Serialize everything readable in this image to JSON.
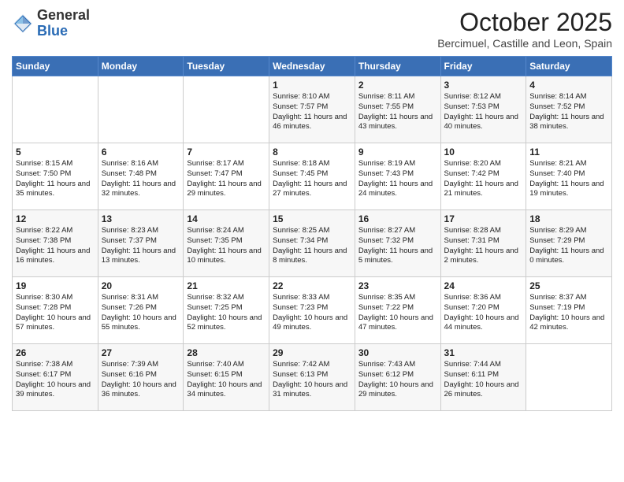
{
  "header": {
    "logo_general": "General",
    "logo_blue": "Blue",
    "month_title": "October 2025",
    "subtitle": "Bercimuel, Castille and Leon, Spain"
  },
  "days_of_week": [
    "Sunday",
    "Monday",
    "Tuesday",
    "Wednesday",
    "Thursday",
    "Friday",
    "Saturday"
  ],
  "weeks": [
    [
      {
        "day": "",
        "info": ""
      },
      {
        "day": "",
        "info": ""
      },
      {
        "day": "",
        "info": ""
      },
      {
        "day": "1",
        "info": "Sunrise: 8:10 AM\nSunset: 7:57 PM\nDaylight: 11 hours\nand 46 minutes."
      },
      {
        "day": "2",
        "info": "Sunrise: 8:11 AM\nSunset: 7:55 PM\nDaylight: 11 hours\nand 43 minutes."
      },
      {
        "day": "3",
        "info": "Sunrise: 8:12 AM\nSunset: 7:53 PM\nDaylight: 11 hours\nand 40 minutes."
      },
      {
        "day": "4",
        "info": "Sunrise: 8:14 AM\nSunset: 7:52 PM\nDaylight: 11 hours\nand 38 minutes."
      }
    ],
    [
      {
        "day": "5",
        "info": "Sunrise: 8:15 AM\nSunset: 7:50 PM\nDaylight: 11 hours\nand 35 minutes."
      },
      {
        "day": "6",
        "info": "Sunrise: 8:16 AM\nSunset: 7:48 PM\nDaylight: 11 hours\nand 32 minutes."
      },
      {
        "day": "7",
        "info": "Sunrise: 8:17 AM\nSunset: 7:47 PM\nDaylight: 11 hours\nand 29 minutes."
      },
      {
        "day": "8",
        "info": "Sunrise: 8:18 AM\nSunset: 7:45 PM\nDaylight: 11 hours\nand 27 minutes."
      },
      {
        "day": "9",
        "info": "Sunrise: 8:19 AM\nSunset: 7:43 PM\nDaylight: 11 hours\nand 24 minutes."
      },
      {
        "day": "10",
        "info": "Sunrise: 8:20 AM\nSunset: 7:42 PM\nDaylight: 11 hours\nand 21 minutes."
      },
      {
        "day": "11",
        "info": "Sunrise: 8:21 AM\nSunset: 7:40 PM\nDaylight: 11 hours\nand 19 minutes."
      }
    ],
    [
      {
        "day": "12",
        "info": "Sunrise: 8:22 AM\nSunset: 7:38 PM\nDaylight: 11 hours\nand 16 minutes."
      },
      {
        "day": "13",
        "info": "Sunrise: 8:23 AM\nSunset: 7:37 PM\nDaylight: 11 hours\nand 13 minutes."
      },
      {
        "day": "14",
        "info": "Sunrise: 8:24 AM\nSunset: 7:35 PM\nDaylight: 11 hours\nand 10 minutes."
      },
      {
        "day": "15",
        "info": "Sunrise: 8:25 AM\nSunset: 7:34 PM\nDaylight: 11 hours\nand 8 minutes."
      },
      {
        "day": "16",
        "info": "Sunrise: 8:27 AM\nSunset: 7:32 PM\nDaylight: 11 hours\nand 5 minutes."
      },
      {
        "day": "17",
        "info": "Sunrise: 8:28 AM\nSunset: 7:31 PM\nDaylight: 11 hours\nand 2 minutes."
      },
      {
        "day": "18",
        "info": "Sunrise: 8:29 AM\nSunset: 7:29 PM\nDaylight: 11 hours\nand 0 minutes."
      }
    ],
    [
      {
        "day": "19",
        "info": "Sunrise: 8:30 AM\nSunset: 7:28 PM\nDaylight: 10 hours\nand 57 minutes."
      },
      {
        "day": "20",
        "info": "Sunrise: 8:31 AM\nSunset: 7:26 PM\nDaylight: 10 hours\nand 55 minutes."
      },
      {
        "day": "21",
        "info": "Sunrise: 8:32 AM\nSunset: 7:25 PM\nDaylight: 10 hours\nand 52 minutes."
      },
      {
        "day": "22",
        "info": "Sunrise: 8:33 AM\nSunset: 7:23 PM\nDaylight: 10 hours\nand 49 minutes."
      },
      {
        "day": "23",
        "info": "Sunrise: 8:35 AM\nSunset: 7:22 PM\nDaylight: 10 hours\nand 47 minutes."
      },
      {
        "day": "24",
        "info": "Sunrise: 8:36 AM\nSunset: 7:20 PM\nDaylight: 10 hours\nand 44 minutes."
      },
      {
        "day": "25",
        "info": "Sunrise: 8:37 AM\nSunset: 7:19 PM\nDaylight: 10 hours\nand 42 minutes."
      }
    ],
    [
      {
        "day": "26",
        "info": "Sunrise: 7:38 AM\nSunset: 6:17 PM\nDaylight: 10 hours\nand 39 minutes."
      },
      {
        "day": "27",
        "info": "Sunrise: 7:39 AM\nSunset: 6:16 PM\nDaylight: 10 hours\nand 36 minutes."
      },
      {
        "day": "28",
        "info": "Sunrise: 7:40 AM\nSunset: 6:15 PM\nDaylight: 10 hours\nand 34 minutes."
      },
      {
        "day": "29",
        "info": "Sunrise: 7:42 AM\nSunset: 6:13 PM\nDaylight: 10 hours\nand 31 minutes."
      },
      {
        "day": "30",
        "info": "Sunrise: 7:43 AM\nSunset: 6:12 PM\nDaylight: 10 hours\nand 29 minutes."
      },
      {
        "day": "31",
        "info": "Sunrise: 7:44 AM\nSunset: 6:11 PM\nDaylight: 10 hours\nand 26 minutes."
      },
      {
        "day": "",
        "info": ""
      }
    ]
  ]
}
